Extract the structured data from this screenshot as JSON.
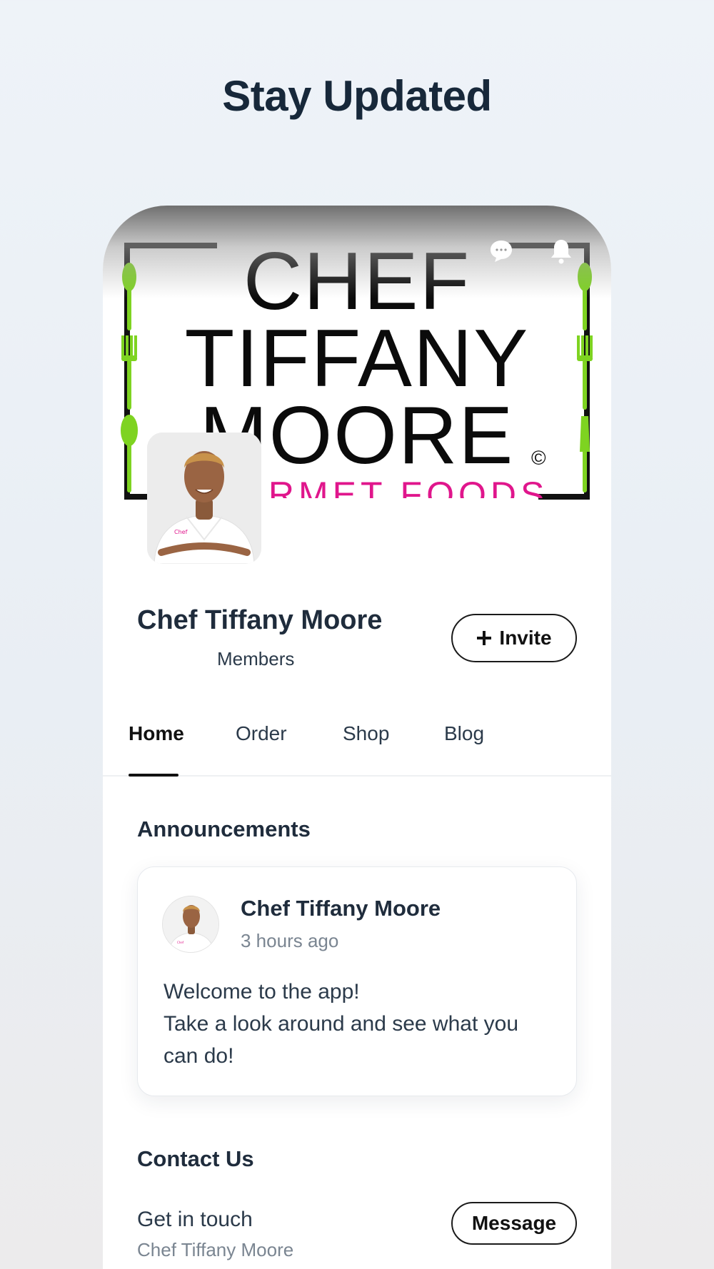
{
  "heading": "Stay Updated",
  "cover": {
    "logo_lines": [
      "CHEF",
      "TIFFANY",
      "MOORE"
    ],
    "logo_sub": "GOURMET FOODS",
    "copyright": "©"
  },
  "profile": {
    "name": "Chef Tiffany Moore",
    "members": "Members",
    "invite_label": "Invite"
  },
  "tabs": [
    {
      "label": "Home",
      "active": true
    },
    {
      "label": "Order",
      "active": false
    },
    {
      "label": "Shop",
      "active": false
    },
    {
      "label": "Blog",
      "active": false
    }
  ],
  "announcements": {
    "title": "Announcements",
    "post": {
      "author": "Chef Tiffany Moore",
      "time": "3 hours ago",
      "body_lines": [
        "Welcome to the app!",
        "Take a look around and see what you",
        "can do!"
      ]
    }
  },
  "contact": {
    "title": "Contact Us",
    "line": "Get in touch",
    "sub": "Chef Tiffany Moore",
    "message_label": "Message"
  },
  "colors": {
    "accent_pink": "#e0168c",
    "utensil_green": "#7ed321",
    "text_dark": "#1f2c3c"
  },
  "icons": [
    "chat-bubble-icon",
    "bell-icon",
    "plus-icon",
    "fork-icon",
    "spoon-icon",
    "knife-icon"
  ]
}
